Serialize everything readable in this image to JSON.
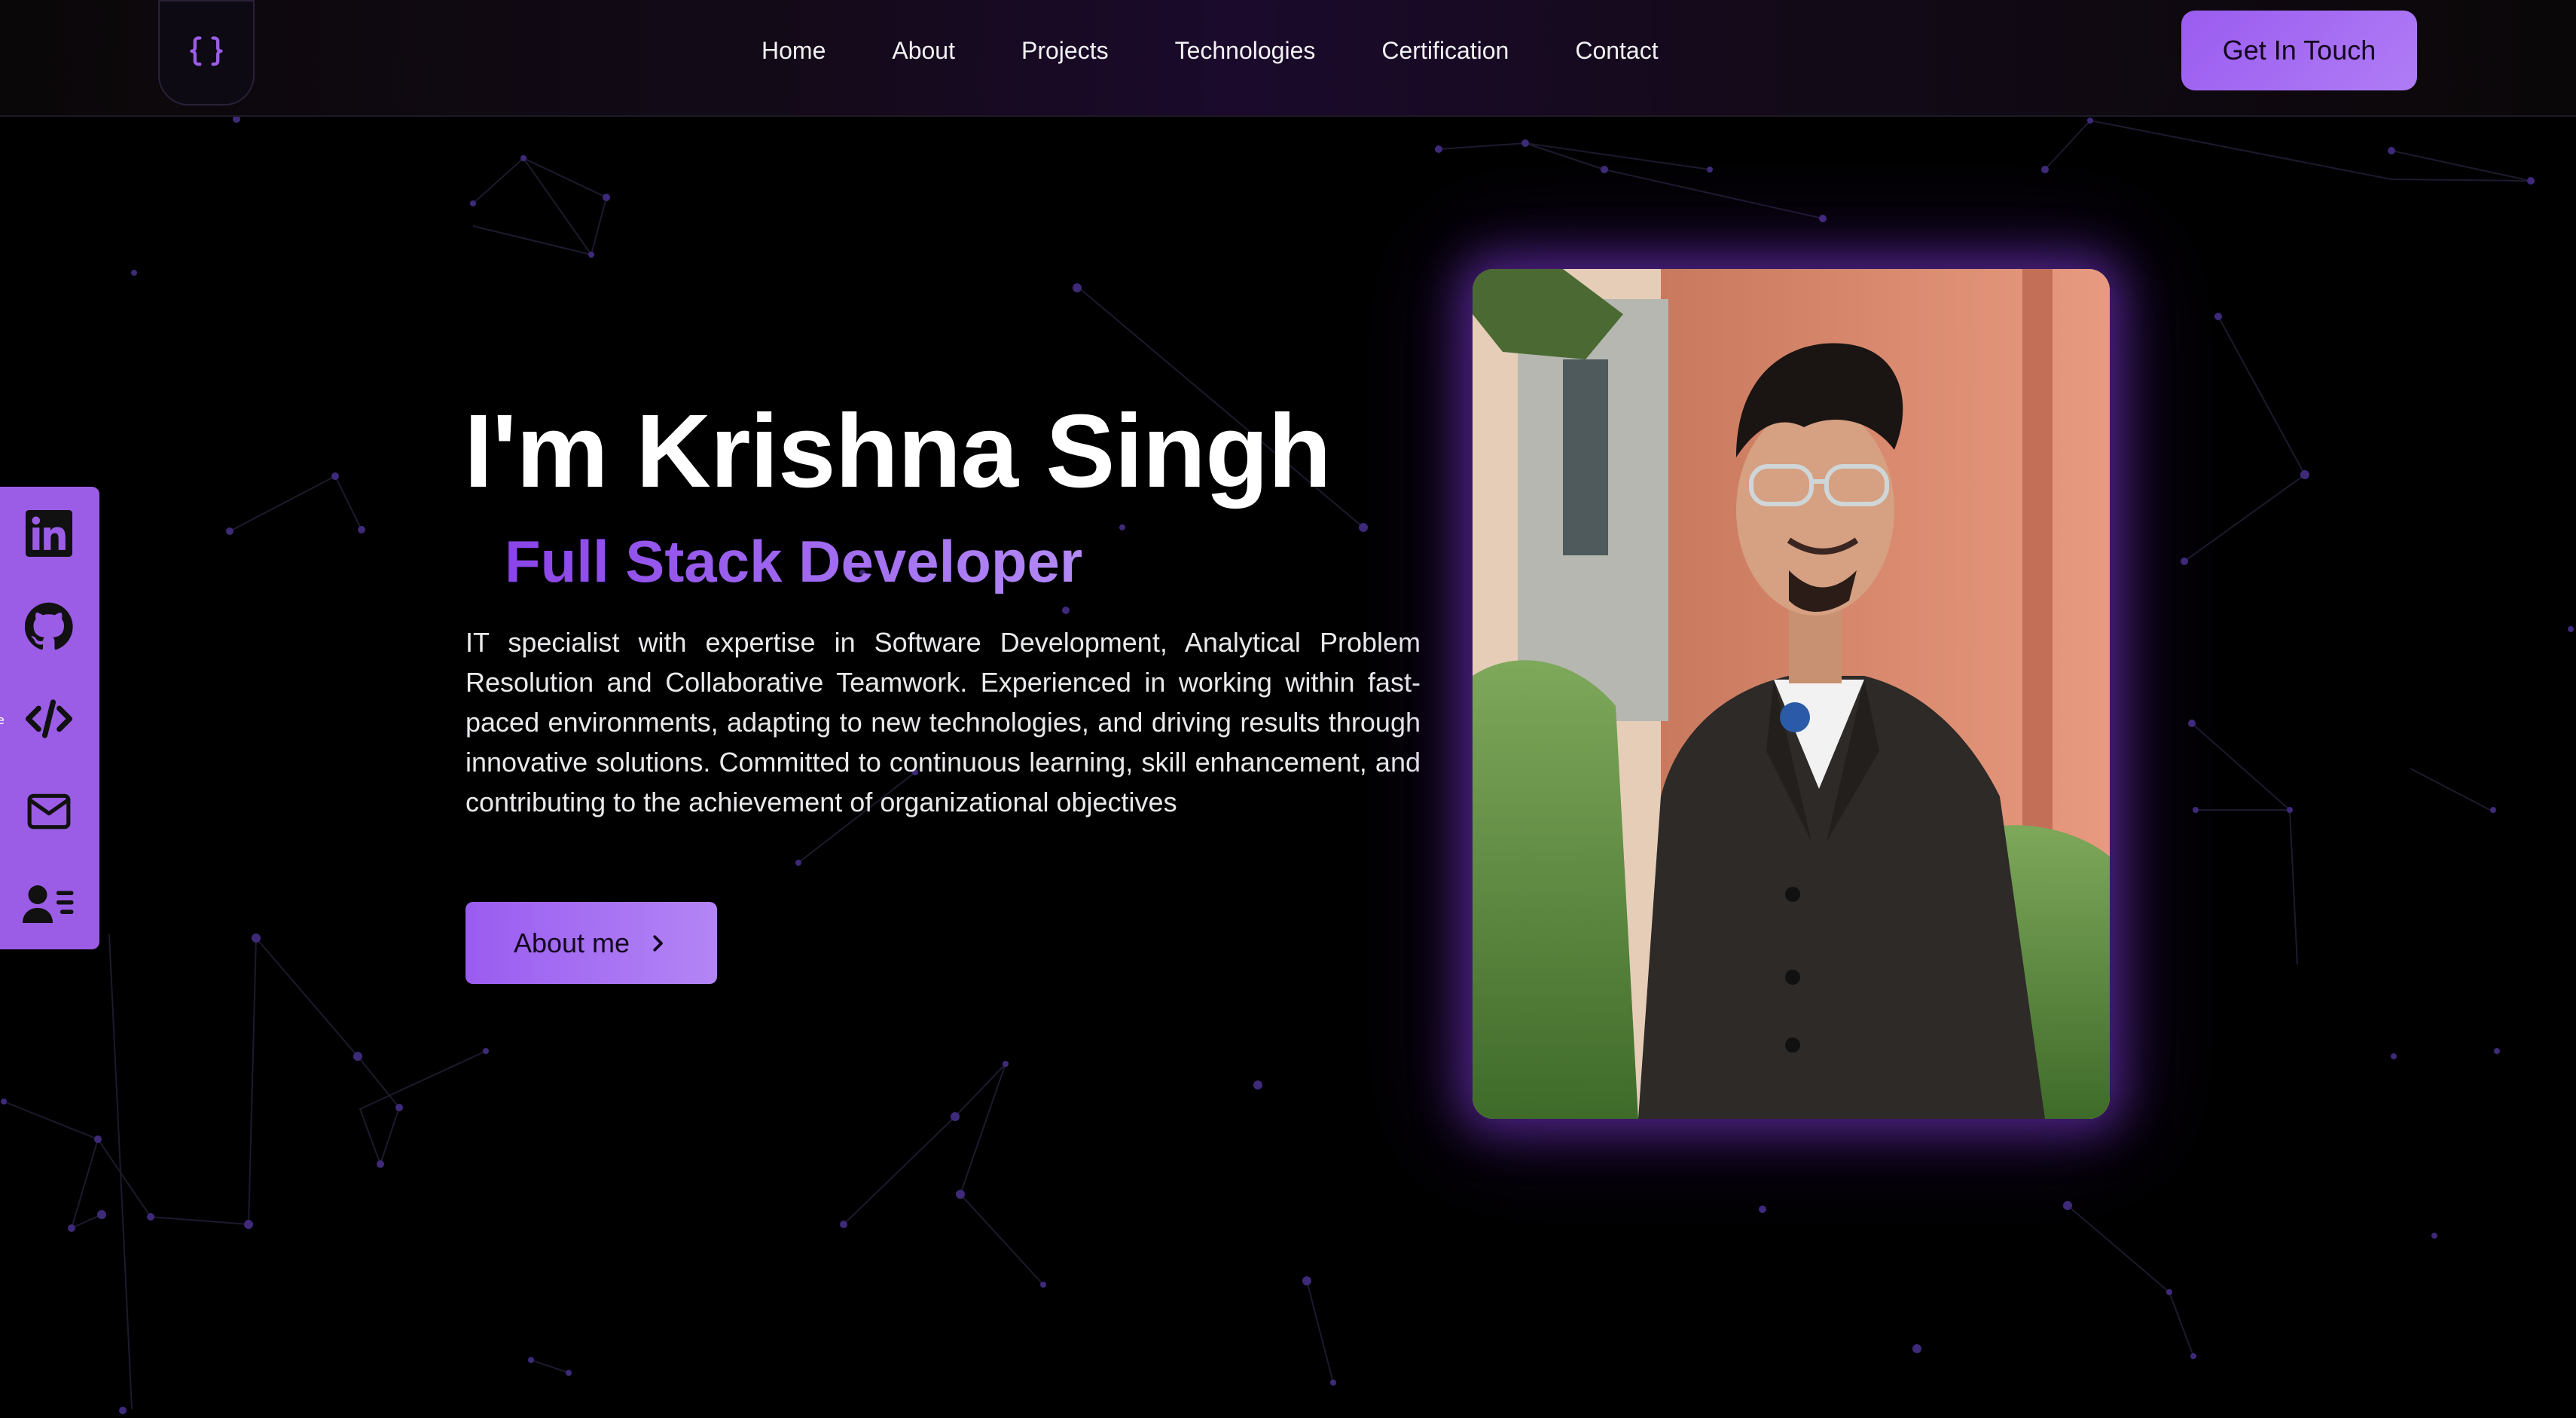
{
  "header": {
    "logo_glyph": "{}",
    "nav": [
      "Home",
      "About",
      "Projects",
      "Technologies",
      "Certification",
      "Contact"
    ],
    "cta_label": "Get In Touch"
  },
  "social": {
    "icons": [
      "linkedin-icon",
      "github-icon",
      "code-icon",
      "mail-icon",
      "resume-icon"
    ],
    "peek_text": "e"
  },
  "hero": {
    "title": "I'm Krishna Singh",
    "role": "Full Stack Developer",
    "description": "IT specialist with expertise in Software Development, Analytical Problem Resolution and Collaborative Teamwork. Experienced in working within fast-paced environments, adapting to new technologies, and driving results through innovative solutions. Committed to continuous learning, skill enhancement, and contributing to the achievement of organizational objectives",
    "button_label": "About me"
  },
  "colors": {
    "accent": "#9b5de5",
    "accent_light": "#b385f5",
    "background": "#000000"
  }
}
